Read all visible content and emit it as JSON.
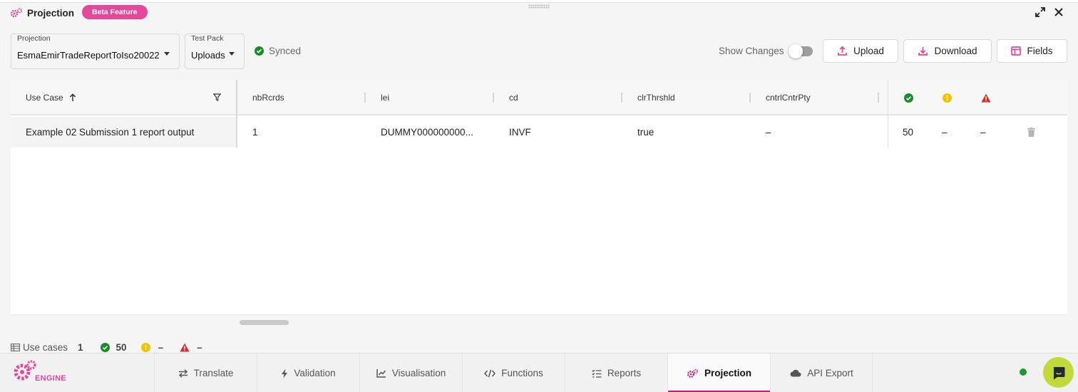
{
  "panel": {
    "title": "Projection",
    "badge": "Beta Feature"
  },
  "controls": {
    "projection_label": "Projection",
    "projection_value": "EsmaEmirTradeReportToIso20022",
    "testpack_label": "Test Pack",
    "testpack_value": "Uploads",
    "synced_text": "Synced",
    "show_changes_label": "Show Changes",
    "show_changes_on": false,
    "upload_label": "Upload",
    "download_label": "Download",
    "fields_label": "Fields"
  },
  "grid": {
    "columns": [
      "Use Case",
      "nbRcrds",
      "lei",
      "cd",
      "clrThrshld",
      "cntrlCntrPty"
    ],
    "sort": "ascending",
    "rows": [
      {
        "use_case": "Example 02 Submission 1 report output",
        "nbRcrds": "1",
        "lei": "DUMMY000000000...",
        "cd": "INVF",
        "clrThrshld": "true",
        "cntrlCntrPty": "–",
        "passed": "50",
        "warnings": "–",
        "errors": "–"
      }
    ]
  },
  "summary": {
    "label": "Use cases",
    "count": "1",
    "passed": "50",
    "warnings": "–",
    "errors": "–"
  },
  "bottom_nav": {
    "logo_text": "ENGINE",
    "tabs": [
      {
        "label": "Translate",
        "icon": "swap-arrows-icon"
      },
      {
        "label": "Validation",
        "icon": "bolt-icon"
      },
      {
        "label": "Visualisation",
        "icon": "line-chart-icon"
      },
      {
        "label": "Functions",
        "icon": "code-icon"
      },
      {
        "label": "Reports",
        "icon": "checklist-icon"
      },
      {
        "label": "Projection",
        "icon": "gears-icon"
      },
      {
        "label": "API Export",
        "icon": "cloud-icon"
      }
    ],
    "active_tab": "Projection"
  },
  "colors": {
    "accent": "#e5479a",
    "active_tab_underline": "#c2217f",
    "success": "#1b8a2e",
    "warning": "#f2c200",
    "error": "#d32f2f",
    "chat_button": "#c3d93b"
  }
}
